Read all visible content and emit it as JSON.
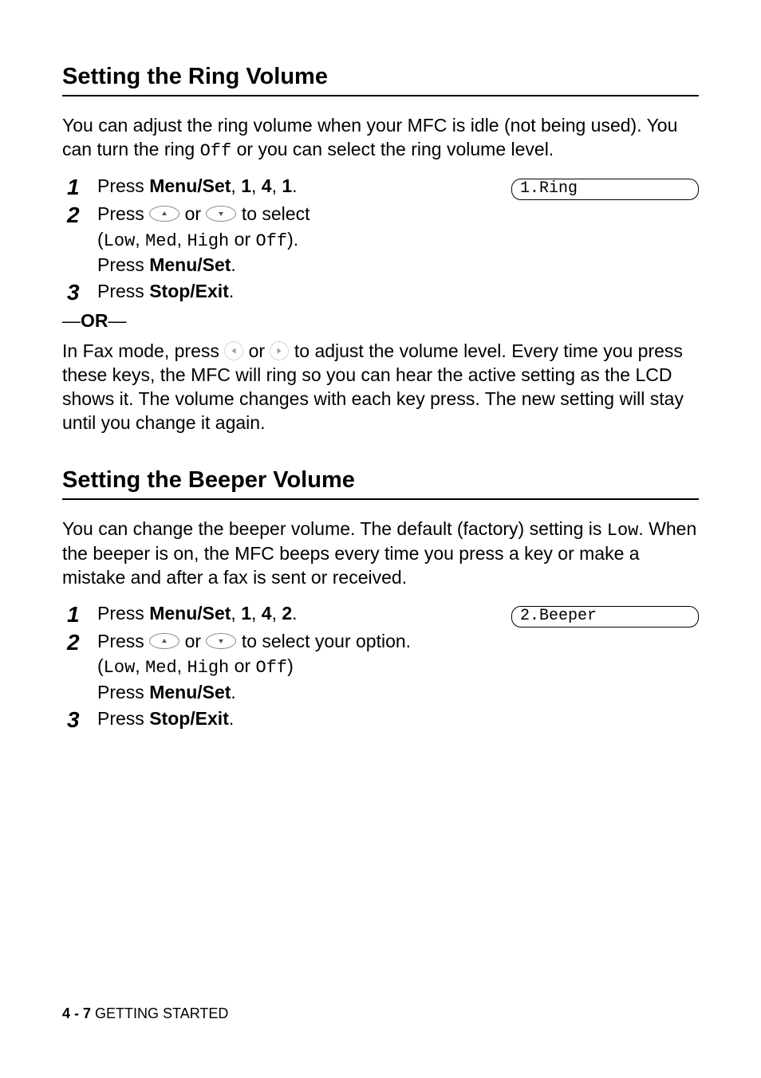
{
  "section1": {
    "heading": "Setting the Ring Volume",
    "intro_prefix": "You can adjust the ring volume when your MFC is idle (not being used). You can turn the ring ",
    "intro_off": "Off",
    "intro_suffix": " or you can select the ring volume level.",
    "steps": {
      "s1": {
        "num": "1",
        "press": "Press ",
        "menuset": "Menu/Set",
        "tail": ", ",
        "n1": "1",
        "n2": "4",
        "n3": "1",
        "period": "."
      },
      "s2": {
        "num": "2",
        "press": "Press ",
        "or": " or ",
        "to_select": " to select",
        "lparen": "(",
        "low": "Low",
        "med": "Med",
        "high": "High",
        "off": "Off",
        "comma": ", ",
        "or2": " or ",
        "rparen": ").",
        "press_line2": "Press ",
        "menuset": "Menu/Set",
        "period": "."
      },
      "s3": {
        "num": "3",
        "press": "Press ",
        "stopexit": "Stop/Exit",
        "period": "."
      }
    },
    "lcd": "1.Ring",
    "or_label": "OR",
    "follow_prefix": "In Fax mode, press ",
    "follow_or": " or ",
    "follow_suffix": " to adjust the volume level. Every time you press these keys, the MFC will ring so you can hear the active setting as the LCD shows it. The volume changes with each key press. The new setting will stay until you change it again."
  },
  "section2": {
    "heading": "Setting the Beeper Volume",
    "intro_prefix": "You can change the beeper volume. The default (factory) setting is ",
    "intro_low": "Low",
    "intro_suffix": ". When the beeper is on, the MFC beeps every time you press a key or make a mistake and after a fax is sent or received.",
    "steps": {
      "s1": {
        "num": "1",
        "press": "Press ",
        "menuset": "Menu/Set",
        "n1": "1",
        "n2": "4",
        "n3": "2"
      },
      "s2": {
        "num": "2",
        "press": "Press ",
        "or": " or ",
        "to_select": " to select your option.",
        "lparen": "(",
        "low": "Low",
        "med": "Med",
        "high": "High",
        "off": "Off",
        "rparen": ")",
        "press_line2": "Press ",
        "menuset": "Menu/Set",
        "period": "."
      },
      "s3": {
        "num": "3",
        "press": "Press ",
        "stopexit": "Stop/Exit",
        "period": "."
      }
    },
    "lcd": "2.Beeper"
  },
  "footer": {
    "page": "4 - 7",
    "label": "   GETTING STARTED"
  },
  "sep_comma": ", "
}
